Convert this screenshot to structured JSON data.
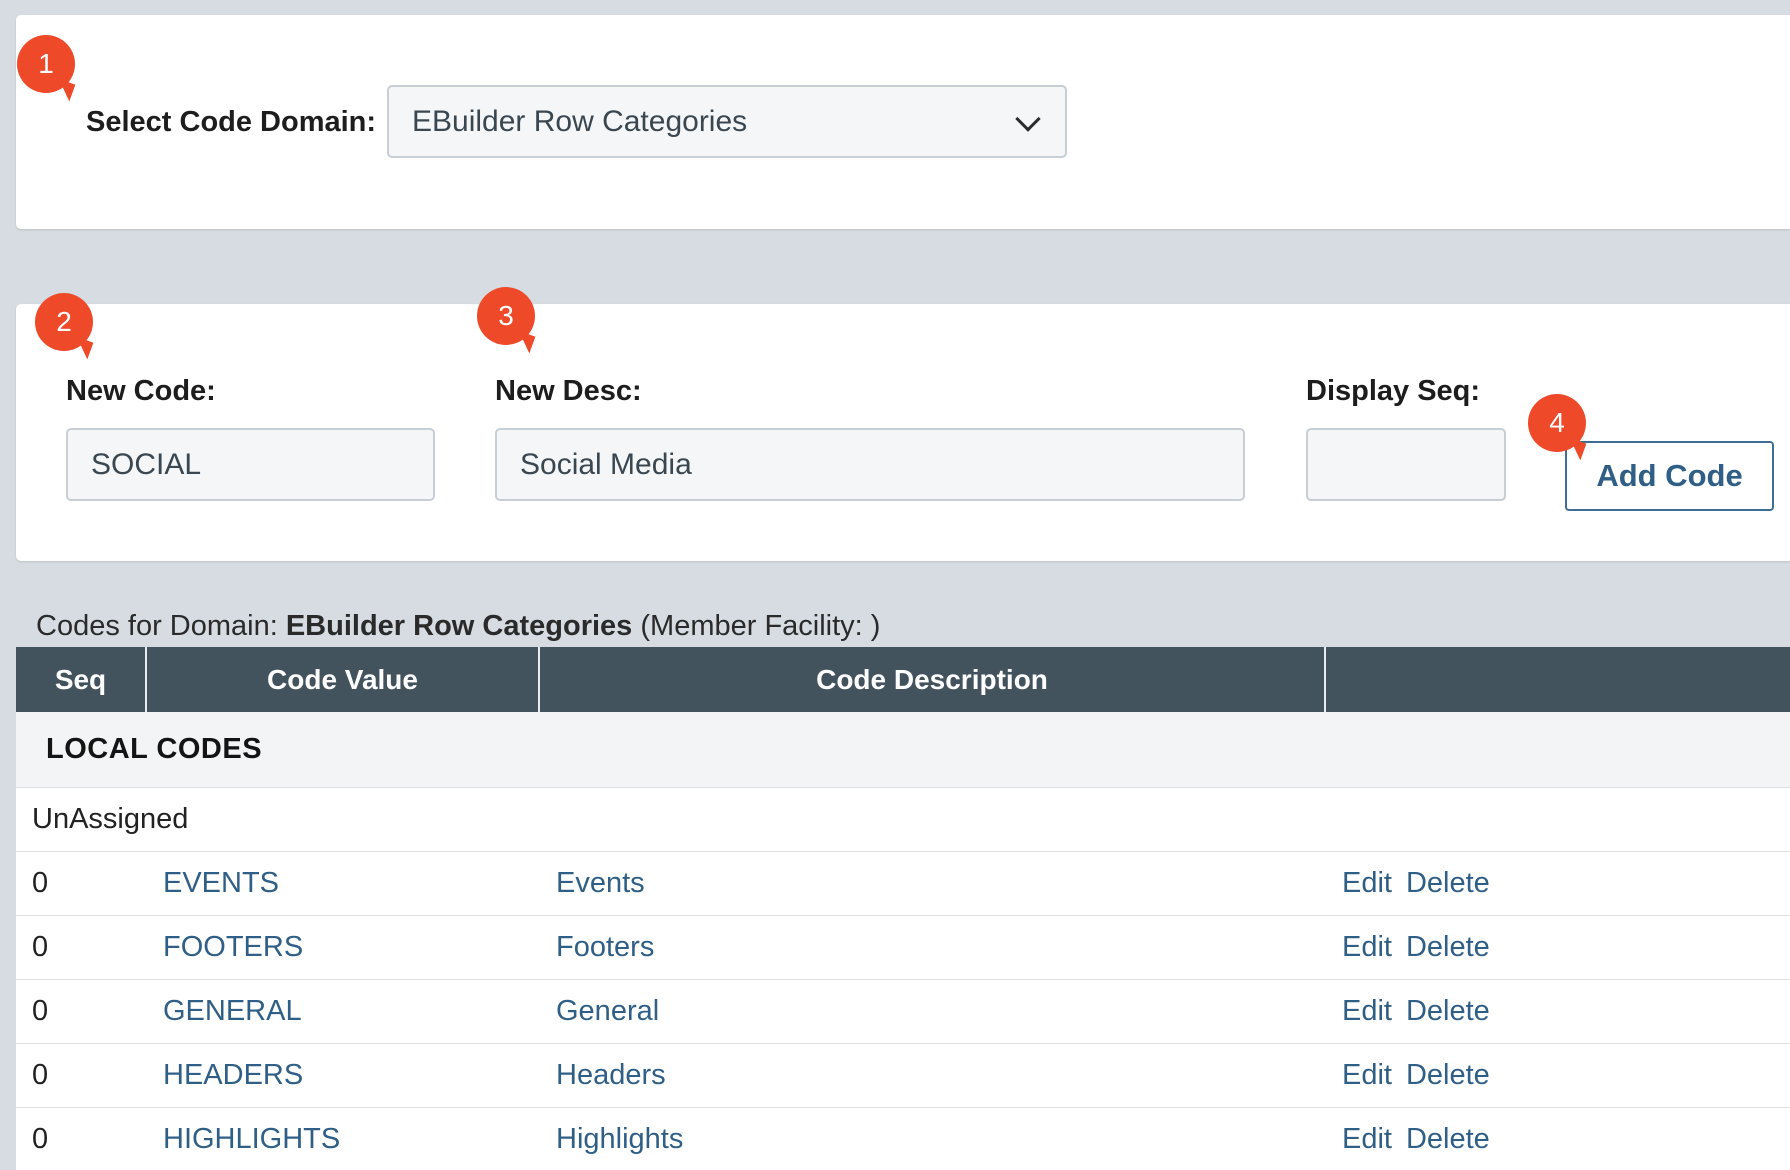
{
  "domain_select": {
    "label": "Select Code Domain:",
    "value": "EBuilder Row Categories",
    "badge": "1"
  },
  "new_code_form": {
    "code_label": "New Code:",
    "code_value": "SOCIAL",
    "code_badge": "2",
    "desc_label": "New Desc:",
    "desc_value": "Social Media",
    "desc_badge": "3",
    "seq_label": "Display Seq:",
    "seq_value": "",
    "add_button": "Add Code",
    "add_badge": "4"
  },
  "caption": {
    "prefix": "Codes for Domain:",
    "domain": "EBuilder Row Categories",
    "suffix": "(Member Facility: )"
  },
  "table": {
    "headers": [
      "Seq",
      "Code Value",
      "Code Description",
      ""
    ],
    "group_label": "LOCAL CODES",
    "sub_label": "UnAssigned",
    "rows": [
      {
        "seq": "0",
        "code": "EVENTS",
        "desc": "Events",
        "edit": "Edit",
        "delete": "Delete"
      },
      {
        "seq": "0",
        "code": "FOOTERS",
        "desc": "Footers",
        "edit": "Edit",
        "delete": "Delete"
      },
      {
        "seq": "0",
        "code": "GENERAL",
        "desc": "General",
        "edit": "Edit",
        "delete": "Delete"
      },
      {
        "seq": "0",
        "code": "HEADERS",
        "desc": "Headers",
        "edit": "Edit",
        "delete": "Delete"
      },
      {
        "seq": "0",
        "code": "HIGHLIGHTS",
        "desc": "Highlights",
        "edit": "Edit",
        "delete": "Delete"
      }
    ]
  },
  "colors": {
    "accent_badge": "#ee4a2a",
    "link": "#2f5f86",
    "header_bg": "#43535e",
    "page_bg": "#d6dce1"
  }
}
